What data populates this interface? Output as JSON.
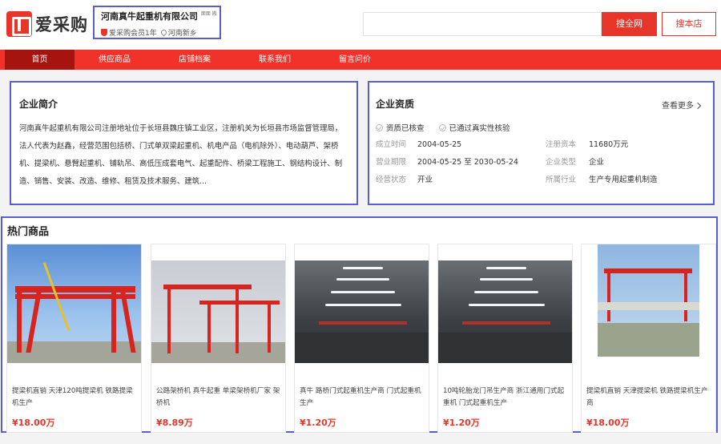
{
  "header": {
    "logo_text": "爱采购",
    "company_name": "河南真牛起重机有限公司",
    "company_name_suffix": "面面 搬",
    "member_text": "爱采购会员1年",
    "location": "河南新乡",
    "search_all_label": "搜全网",
    "search_store_label": "搜本店"
  },
  "nav": {
    "items": [
      {
        "label": "首页",
        "active": true
      },
      {
        "label": "供应商品"
      },
      {
        "label": "店铺档案"
      },
      {
        "label": "联系我们"
      },
      {
        "label": "留言问价"
      }
    ]
  },
  "intro": {
    "title": "企业简介",
    "text": "河南真牛起重机有限公司注册地址位于长垣县魏庄镇工业区，注册机关为长垣县市场监督管理局，法人代表为赵鑫，经营范围包括桥、门式单双梁起重机、机电产品（电机除外）、电动葫芦、架桥机、提梁机、悬臂起重机、铺轨吊、高低压成套电气、起重配件、桥梁工程施工、钢结构设计、制造、销售、安装、改造、维修、租赁及技术服务、建筑..."
  },
  "qualification": {
    "title": "企业资质",
    "more_label": "查看更多",
    "badges": [
      "资质已核查",
      "已通过真实性核验"
    ],
    "established_label": "成立时间",
    "established": "2004-05-25",
    "capital_label": "注册资本",
    "capital": "11680万元",
    "term_label": "营业期限",
    "term": "2004-05-25 至 2030-05-24",
    "type_label": "企业类型",
    "type": "企业",
    "status_label": "经营状态",
    "status": "开业",
    "industry_label": "所属行业",
    "industry": "生产专用起重机制造"
  },
  "hot": {
    "title": "热门商品",
    "products": [
      {
        "name": "提梁机直销 天津120吨提梁机 铁路提梁机生产",
        "price": "¥18.00万"
      },
      {
        "name": "公路架桥机 真牛起重 单梁架桥机厂家 架桥机",
        "price": "¥8.89万"
      },
      {
        "name": "真牛 路桥门式起重机生产商 门式起重机生产",
        "price": "¥1.20万"
      },
      {
        "name": "10吨轮胎龙门吊生产商 浙江通用门式起重机 门式起重机生产",
        "price": "¥1.20万"
      },
      {
        "name": "提梁机直销 天津提梁机 铁路提梁机生产商",
        "price": "¥18.00万"
      }
    ]
  },
  "colors": {
    "brand_red": "#e8352a",
    "nav_red": "#f0322b",
    "nav_active": "#a5140e",
    "highlight_border": "#5a5fd0"
  }
}
